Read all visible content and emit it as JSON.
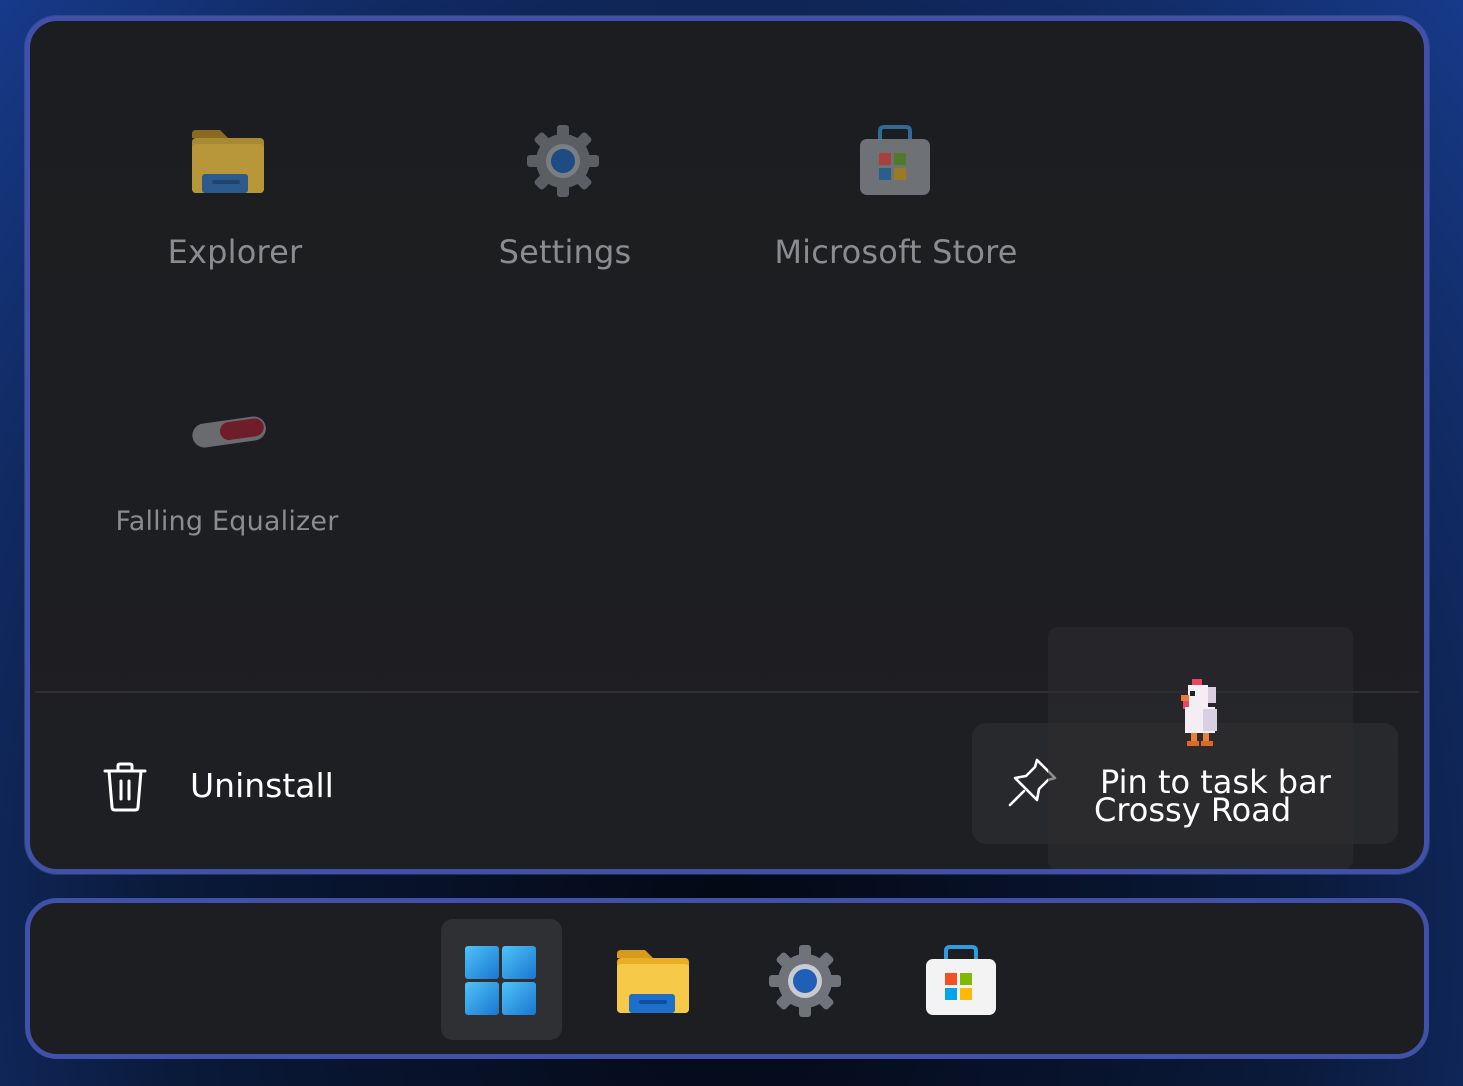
{
  "start_menu": {
    "apps": [
      {
        "label": "Explorer",
        "icon": "folder-icon"
      },
      {
        "label": "Settings",
        "icon": "gear-icon"
      },
      {
        "label": "Microsoft Store",
        "icon": "store-bag-icon"
      },
      {
        "label": "Falling Equalizer",
        "icon": "capsule-icon"
      }
    ],
    "context_menu": {
      "uninstall_label": "Uninstall",
      "uninstall_icon": "trash-icon",
      "pin_label": "Pin to task bar",
      "pin_icon": "pin-icon"
    },
    "drag_item": {
      "label": "Crossy Road",
      "icon": "chicken-icon"
    }
  },
  "taskbar": {
    "items": [
      {
        "name": "start",
        "icon": "windows-logo-icon",
        "active": true
      },
      {
        "name": "explorer",
        "icon": "folder-icon"
      },
      {
        "name": "settings",
        "icon": "gear-icon"
      },
      {
        "name": "store",
        "icon": "store-bag-icon"
      }
    ]
  },
  "colors": {
    "accent_border": "#4150a8",
    "panel_bg": "#1e1f22",
    "text_dim": "#8b8c90",
    "text_bright": "#ffffff"
  }
}
